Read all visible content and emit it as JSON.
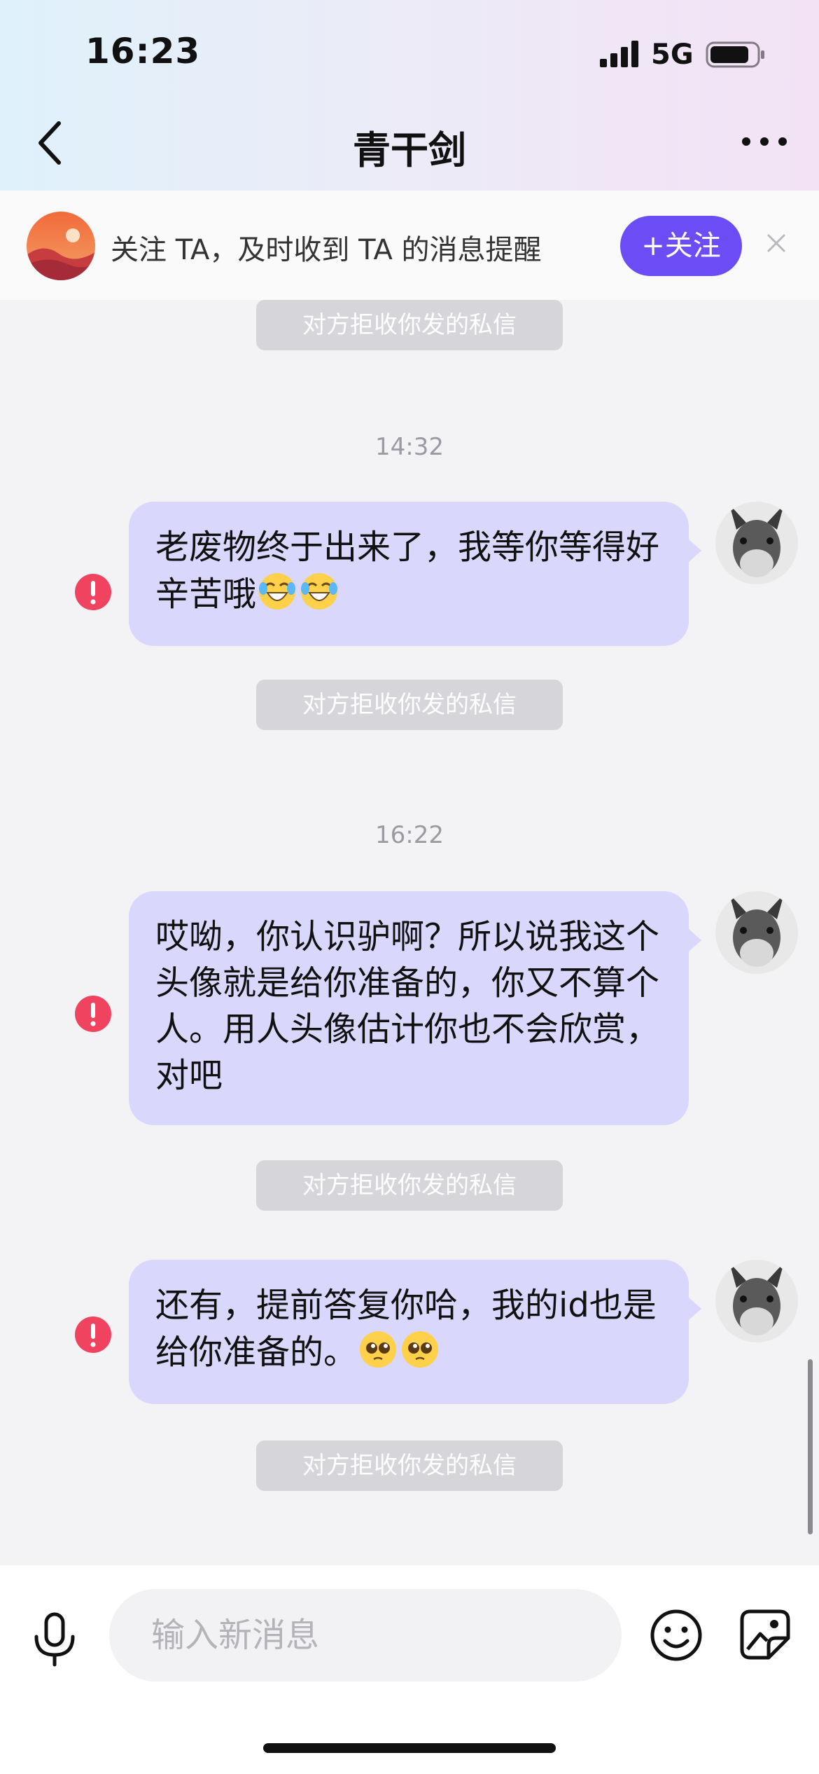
{
  "status_bar": {
    "time": "16:23",
    "network": "5G",
    "battery_level": 0.8
  },
  "nav": {
    "title": "青干剑",
    "icons": [
      "back-icon",
      "more-icon"
    ]
  },
  "follow_banner": {
    "text": "关注 TA，及时收到 TA 的消息提醒",
    "button_label": "+关注"
  },
  "chat": {
    "notices": [
      "对方拒收你发的私信",
      "对方拒收你发的私信",
      "对方拒收你发的私信",
      "对方拒收你发的私信"
    ],
    "timestamps": [
      "14:32",
      "16:22"
    ],
    "messages": [
      {
        "text": "老废物终于出来了，我等你等得好辛苦哦",
        "emoji": "crying-laughing-emoji",
        "emoji_count": 2,
        "status": "failed"
      },
      {
        "text": "哎呦，你认识驴啊？所以说我这个头像就是给你准备的，你又不算个人。用人头像估计你也不会欣赏，对吧",
        "status": "failed"
      },
      {
        "text": "还有，提前答复你哈，我的id也是给你准备的。",
        "emoji": "pleading-face-emoji",
        "emoji_count": 2,
        "status": "failed"
      }
    ]
  },
  "input": {
    "placeholder": "输入新消息",
    "value": ""
  },
  "colors": {
    "bubble": "#d9d7fc",
    "accent": "#6b4cf5",
    "error": "#f0435f",
    "notice_bg": "#d6d6da"
  }
}
